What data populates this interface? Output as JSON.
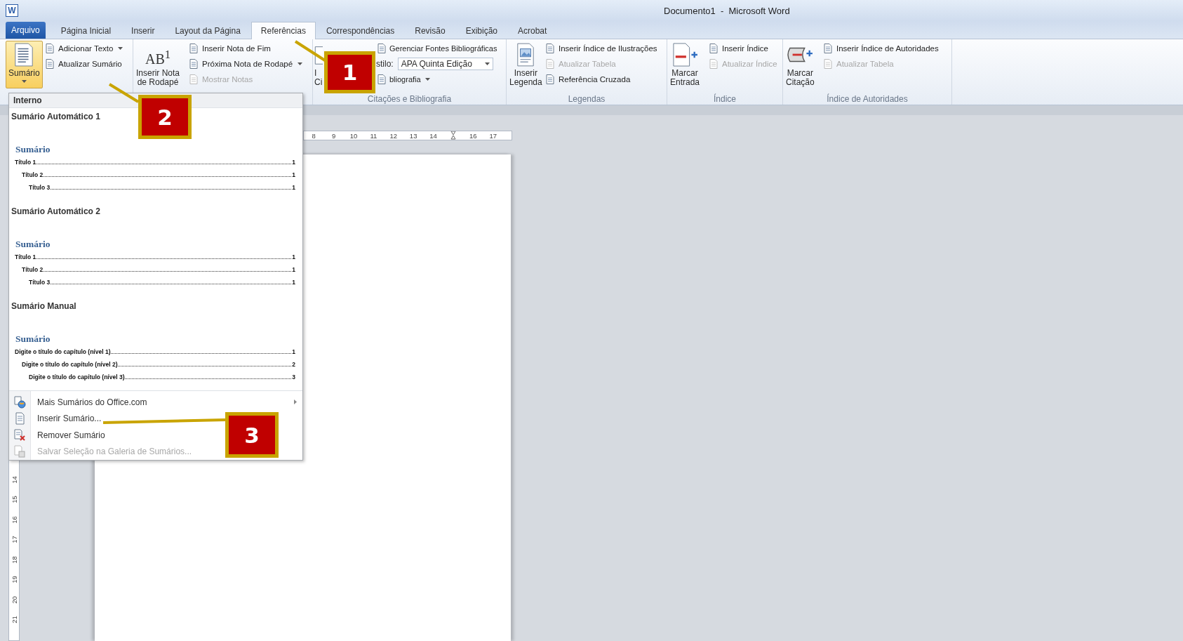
{
  "window": {
    "icon_letter": "W",
    "title": "Documento1  -  Microsoft Word"
  },
  "tabs": [
    {
      "label": "Arquivo",
      "kind": "file",
      "selected": false
    },
    {
      "label": "Página Inicial",
      "kind": "tab",
      "selected": false
    },
    {
      "label": "Inserir",
      "kind": "tab",
      "selected": false
    },
    {
      "label": "Layout da Página",
      "kind": "tab",
      "selected": false
    },
    {
      "label": "Referências",
      "kind": "tab",
      "selected": true
    },
    {
      "label": "Correspondências",
      "kind": "tab",
      "selected": false
    },
    {
      "label": "Revisão",
      "kind": "tab",
      "selected": false
    },
    {
      "label": "Exibição",
      "kind": "tab",
      "selected": false
    },
    {
      "label": "Acrobat",
      "kind": "tab",
      "selected": false
    }
  ],
  "ribbon": {
    "groups": [
      {
        "large": [
          {
            "lines": [
              "Sumário"
            ],
            "selected": true,
            "has_menu": true
          }
        ],
        "small": [
          {
            "kind": "button",
            "label": "Adicionar Texto",
            "has_menu": true,
            "disabled": false
          },
          {
            "kind": "button",
            "label": "Atualizar Sumário",
            "has_menu": false,
            "disabled": false
          }
        ]
      },
      {
        "large": [
          {
            "lines": [
              "Inserir Nota",
              "de Rodapé"
            ],
            "icon_text": "AB$^{1}$",
            "selected": false
          }
        ],
        "small": [
          {
            "kind": "button",
            "label": "Inserir Nota de Fim",
            "has_menu": false,
            "disabled": false
          },
          {
            "kind": "button",
            "label": "Próxima Nota de Rodapé",
            "has_menu": true,
            "disabled": false
          },
          {
            "kind": "button",
            "label": "Mostrar Notas",
            "has_menu": false,
            "disabled": true
          }
        ]
      },
      {
        "label": "Citações e Bibliografia",
        "large": [
          {
            "lines": [
              "I",
              "Ci"
            ],
            "selected": false
          }
        ],
        "small": [
          {
            "kind": "button",
            "label": "Gerenciar Fontes Bibliográficas",
            "has_menu": false,
            "disabled": false
          },
          {
            "kind": "select",
            "label": "stilo:",
            "value": "APA Quinta Edição"
          },
          {
            "kind": "button",
            "label": "bliografia",
            "has_menu": true,
            "disabled": false
          }
        ]
      },
      {
        "label": "Legendas",
        "large": [
          {
            "lines": [
              "Inserir",
              "Legenda"
            ],
            "selected": false
          }
        ],
        "small": [
          {
            "kind": "button",
            "label": "Inserir Índice de Ilustrações",
            "has_menu": false,
            "disabled": false
          },
          {
            "kind": "button",
            "label": "Atualizar Tabela",
            "has_menu": false,
            "disabled": true
          },
          {
            "kind": "button",
            "label": "Referência Cruzada",
            "has_menu": false,
            "disabled": false
          }
        ]
      },
      {
        "label": "Índice",
        "large": [
          {
            "lines": [
              "Marcar",
              "Entrada"
            ],
            "selected": false
          }
        ],
        "small": [
          {
            "kind": "button",
            "label": "Inserir Índice",
            "has_menu": false,
            "disabled": false
          },
          {
            "kind": "button",
            "label": "Atualizar Índice",
            "has_menu": false,
            "disabled": true
          }
        ]
      },
      {
        "label": "Índice de Autoridades",
        "large": [
          {
            "lines": [
              "Marcar",
              "Citação"
            ],
            "selected": false
          }
        ],
        "small": [
          {
            "kind": "button",
            "label": "Inserir Índice de Autoridades",
            "has_menu": false,
            "disabled": false
          },
          {
            "kind": "button",
            "label": "Atualizar Tabela",
            "has_menu": false,
            "disabled": true
          }
        ]
      }
    ]
  },
  "ruler": {
    "marks": [
      {
        "kind": "number",
        "label": "8"
      },
      {
        "kind": "number",
        "label": "9"
      },
      {
        "kind": "number",
        "label": "10"
      },
      {
        "kind": "number",
        "label": "11"
      },
      {
        "kind": "number",
        "label": "12"
      },
      {
        "kind": "number",
        "label": "13"
      },
      {
        "kind": "number",
        "label": "14"
      },
      {
        "kind": "indent-marker"
      },
      {
        "kind": "number",
        "label": "16"
      },
      {
        "kind": "number",
        "label": "17"
      }
    ]
  },
  "vertical_ruler": {
    "numbers": [
      "14",
      "15",
      "16",
      "17",
      "18",
      "19",
      "20",
      "21"
    ]
  },
  "dropdown": {
    "header": "Interno",
    "gallery": [
      {
        "title": "Sumário Automático 1",
        "heading": "Sumário",
        "entries": [
          {
            "text": "Título 1",
            "page": "1",
            "children": [
              {
                "text": "Título 2",
                "page": "1",
                "children": [
                  {
                    "text": "Título 3",
                    "page": "1"
                  }
                ]
              }
            ]
          }
        ]
      },
      {
        "title": "Sumário Automático 2",
        "heading": "Sumário",
        "entries": [
          {
            "text": "Título 1",
            "page": "1",
            "children": [
              {
                "text": "Título 2",
                "page": "1",
                "children": [
                  {
                    "text": "Título 3",
                    "page": "1"
                  }
                ]
              }
            ]
          }
        ]
      },
      {
        "title": "Sumário Manual",
        "heading": "Sumário",
        "entries": [
          {
            "text": "Digite o título do capítulo (nível 1)",
            "page": "1",
            "children": [
              {
                "text": "Digite o título do capítulo (nível 2)",
                "page": "2",
                "children": [
                  {
                    "text": "Digite o título do capítulo (nível 3)",
                    "page": "3"
                  }
                ]
              }
            ]
          }
        ]
      }
    ],
    "menu_items": [
      {
        "label": "Mais Sumários do Office.com",
        "has_submenu": true,
        "disabled": false
      },
      {
        "label": "Inserir Sumário...",
        "has_submenu": false,
        "disabled": false
      },
      {
        "label": "Remover Sumário",
        "has_submenu": false,
        "disabled": false
      },
      {
        "label": "Salvar Seleção na Galeria de Sumários...",
        "has_submenu": false,
        "disabled": true
      }
    ]
  },
  "annotations": [
    {
      "number": "1"
    },
    {
      "number": "2"
    },
    {
      "number": "3"
    }
  ]
}
